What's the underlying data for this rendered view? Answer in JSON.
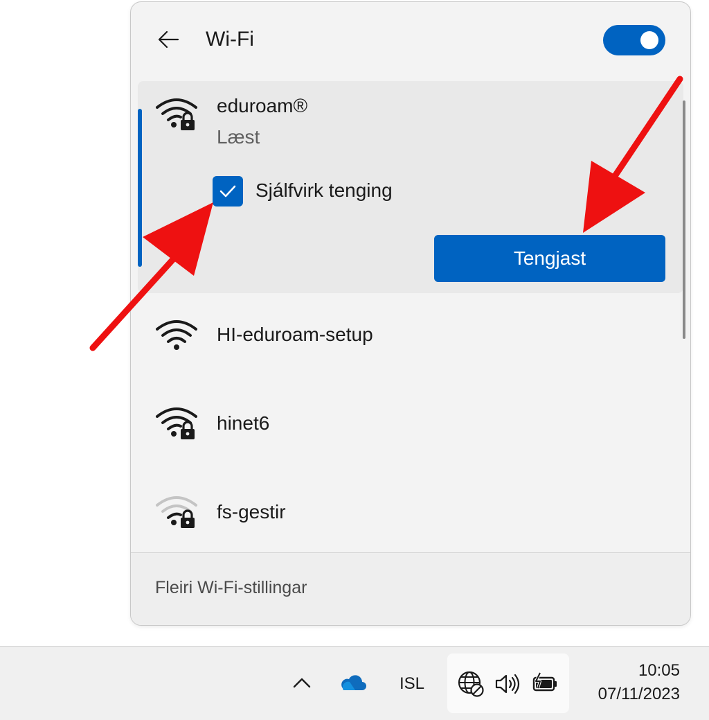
{
  "panel": {
    "title": "Wi-Fi",
    "wifi_enabled": true,
    "footer_link": "Fleiri Wi-Fi-stillingar"
  },
  "networks": [
    {
      "name": "eduroam®",
      "status": "Læst",
      "icon": "wifi-secured-icon",
      "expanded": true,
      "auto_connect_label": "Sjálfvirk tenging",
      "auto_connect_checked": true,
      "connect_label": "Tengjast"
    },
    {
      "name": "HI-eduroam-setup",
      "icon": "wifi-open-icon"
    },
    {
      "name": "hinet6",
      "icon": "wifi-secured-icon"
    },
    {
      "name": "fs-gestir",
      "icon": "wifi-secured-weak-icon"
    }
  ],
  "taskbar": {
    "language": "ISL",
    "time": "10:05",
    "date": "07/11/2023",
    "icons": [
      "chevron-up-icon",
      "onedrive-cloud-icon",
      "globe-no-internet-icon",
      "speaker-icon",
      "battery-charging-icon"
    ]
  },
  "colors": {
    "accent": "#0063c1",
    "panel_bg": "#f3f3f3",
    "arrow": "#ee1111"
  }
}
